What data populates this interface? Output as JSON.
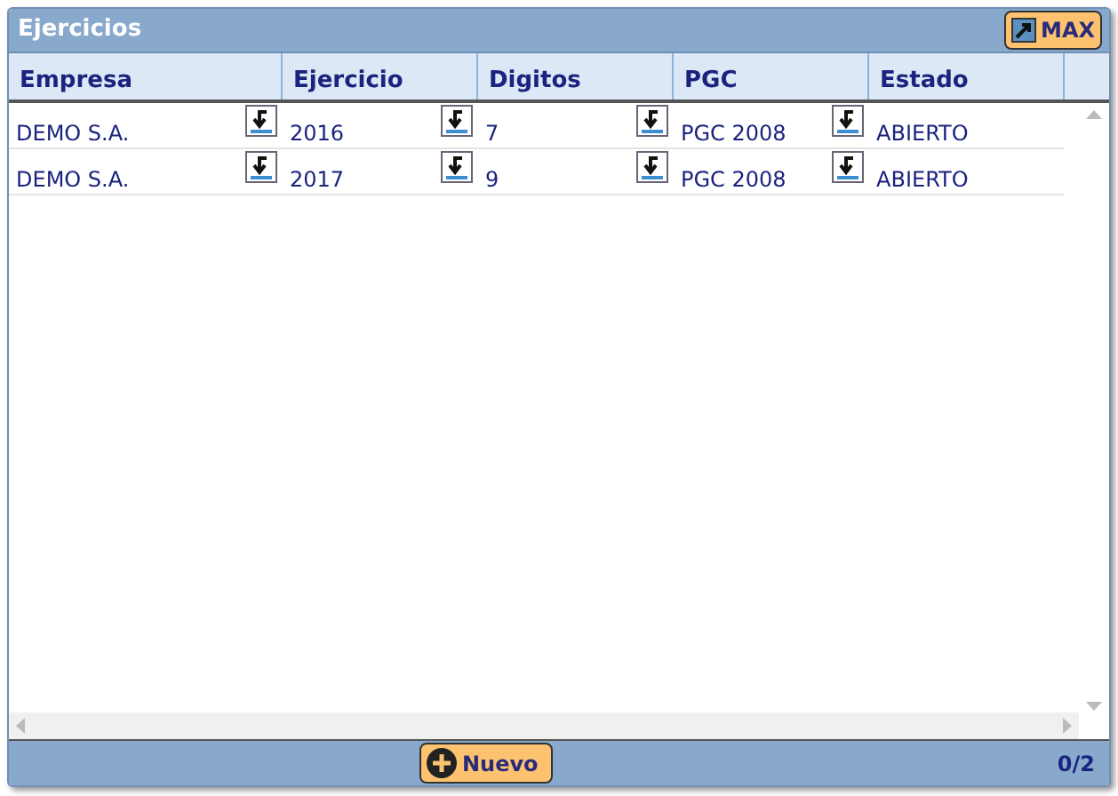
{
  "window": {
    "title": "Ejercicios",
    "max_button": "MAX"
  },
  "table": {
    "columns": [
      "Empresa",
      "Ejercicio",
      "Digitos",
      "PGC",
      "Estado"
    ],
    "rows": [
      [
        "DEMO S.A.",
        "2016",
        "7",
        "PGC 2008",
        "ABIERTO"
      ],
      [
        "DEMO S.A.",
        "2017",
        "9",
        "PGC 2008",
        "ABIERTO"
      ]
    ]
  },
  "footer": {
    "new_button": "Nuevo",
    "count": "0/2"
  }
}
